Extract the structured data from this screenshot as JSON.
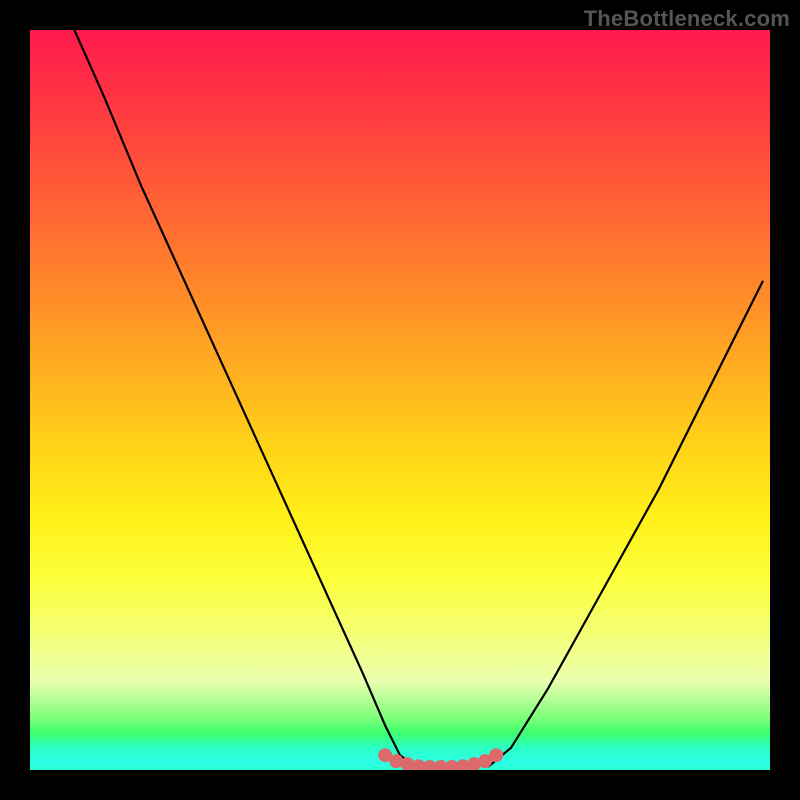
{
  "watermark": "TheBottleneck.com",
  "colors": {
    "background": "#000000",
    "curve_stroke": "#000000",
    "marker_fill": "#dd6a6a",
    "marker_stroke": "#c95656"
  },
  "chart_data": {
    "type": "line",
    "title": "",
    "xlabel": "",
    "ylabel": "",
    "xlim": [
      0,
      100
    ],
    "ylim": [
      0,
      100
    ],
    "grid": false,
    "legend": false,
    "series": [
      {
        "name": "left-curve",
        "x": [
          6,
          10,
          15,
          20,
          25,
          30,
          35,
          40,
          45,
          48,
          50,
          52
        ],
        "values": [
          100,
          91,
          79,
          68,
          57,
          46,
          35,
          24,
          13,
          6,
          2,
          0.5
        ]
      },
      {
        "name": "right-curve",
        "x": [
          62,
          65,
          70,
          75,
          80,
          85,
          90,
          95,
          99
        ],
        "values": [
          0.5,
          3,
          11,
          20,
          29,
          38,
          48,
          58,
          66
        ]
      },
      {
        "name": "trough-marker",
        "x": [
          48,
          49.5,
          51,
          52.5,
          54,
          55.5,
          57,
          58.5,
          60,
          61.5,
          63
        ],
        "values": [
          2.0,
          1.2,
          0.8,
          0.5,
          0.4,
          0.4,
          0.4,
          0.5,
          0.8,
          1.2,
          2.0
        ]
      }
    ]
  }
}
